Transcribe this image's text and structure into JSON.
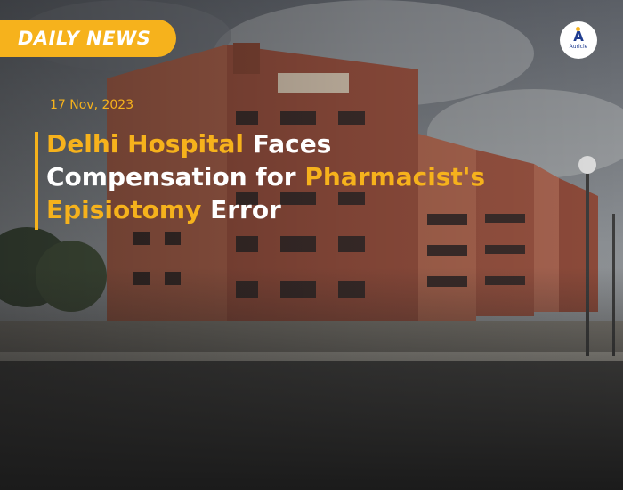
{
  "banner": {
    "label": "DAILY NEWS"
  },
  "logo": {
    "name": "Auricle",
    "mark": "A"
  },
  "article": {
    "date": "17 Nov, 2023",
    "headline": {
      "line1_highlight": "Delhi Hospital",
      "line1_rest": " Faces",
      "line2_start": "Compensation for ",
      "line2_highlight": "Pharmacist's",
      "line3_highlight": "Episiotomy",
      "line3_rest": " Error"
    }
  },
  "colors": {
    "accent": "#f6b21c",
    "text": "#ffffff",
    "logo_blue": "#1f3c8f"
  }
}
